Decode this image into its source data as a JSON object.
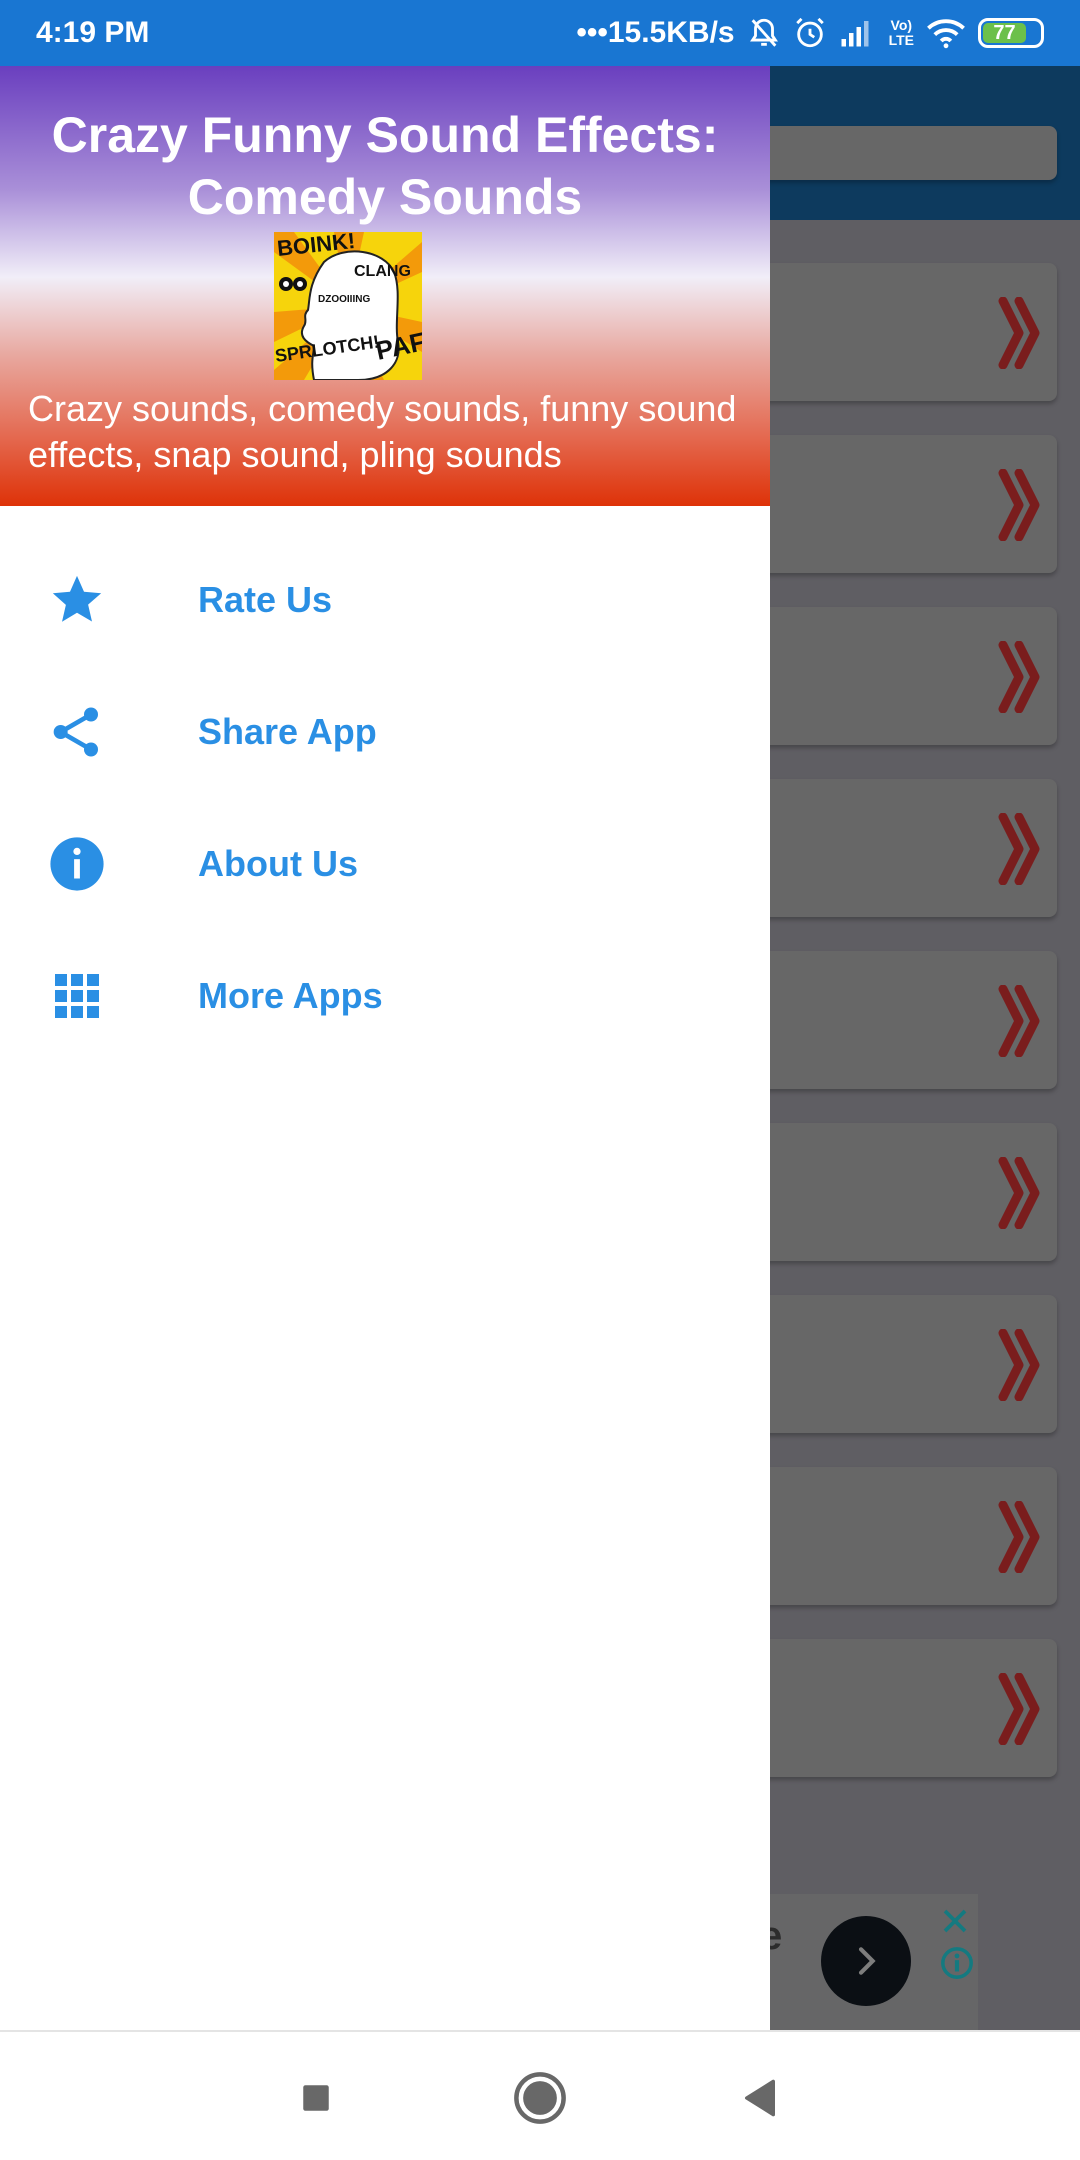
{
  "status_bar": {
    "time": "4:19 PM",
    "network_speed": "15.5KB/s",
    "dots": "•••",
    "icons": [
      "notifications-muted-icon",
      "alarm-icon",
      "signal-icon",
      "volte-icon",
      "wifi-icon",
      "battery-icon"
    ],
    "volte_label_top": "Vo)",
    "volte_label_bottom": "LTE",
    "battery_percent": "77",
    "battery_level": 0.77
  },
  "drawer": {
    "header": {
      "title": "Crazy Funny Sound Effects: Comedy Sounds",
      "logo_words": [
        "BOINK!",
        "CLANG",
        "DZOOIIING",
        "SPRLOTCH!",
        "PAF"
      ],
      "subtitle": "Crazy sounds, comedy sounds, funny sound effects, snap sound, pling sounds"
    },
    "items": [
      {
        "label": "Rate Us",
        "icon": "star-icon"
      },
      {
        "label": "Share App",
        "icon": "share-icon"
      },
      {
        "label": "About Us",
        "icon": "info-icon"
      },
      {
        "label": "More Apps",
        "icon": "apps-grid-icon"
      }
    ],
    "accent_color": "#2a8fe4"
  },
  "background_app": {
    "toolbar_color": "#0d3a5e",
    "list_item_count": 10,
    "list_item_icon": "double-chevron-right-icon",
    "ad": {
      "visible_text": "e",
      "next_icon": "chevron-right-icon",
      "close_icon": "close-icon",
      "info_icon": "info-outline-icon"
    }
  },
  "nav_bar": {
    "buttons": [
      "recents-button",
      "home-button",
      "back-button"
    ]
  }
}
